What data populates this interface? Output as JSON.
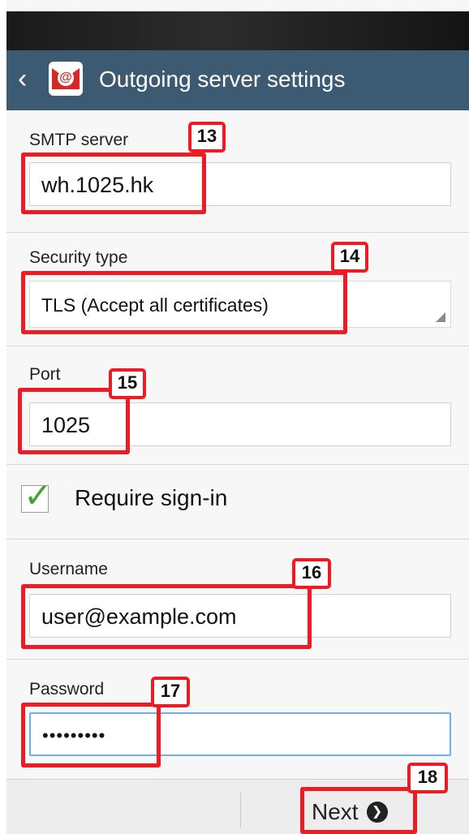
{
  "app_bar": {
    "back_glyph": "‹",
    "title": "Outgoing server settings",
    "icon": "email-app-icon"
  },
  "fields": {
    "smtp_server": {
      "label": "SMTP server",
      "value": "wh.1025.hk"
    },
    "security_type": {
      "label": "Security type",
      "value": "TLS (Accept all certificates)"
    },
    "port": {
      "label": "Port",
      "value": "1025"
    },
    "require_signin": {
      "label": "Require sign-in",
      "checked": true
    },
    "username": {
      "label": "Username",
      "value": "user@example.com"
    },
    "password": {
      "label": "Password",
      "value": "•••••••••"
    }
  },
  "footer": {
    "next_label": "Next",
    "next_glyph": "❯"
  },
  "annotations": {
    "badge_13": "13",
    "badge_14": "14",
    "badge_15": "15",
    "badge_16": "16",
    "badge_17": "17",
    "badge_18": "18"
  },
  "colors": {
    "app_bar": "#3d5a73",
    "highlight": "#ee1b24",
    "checkmark": "#4aa23a",
    "focus_border": "#6fb1e6"
  }
}
